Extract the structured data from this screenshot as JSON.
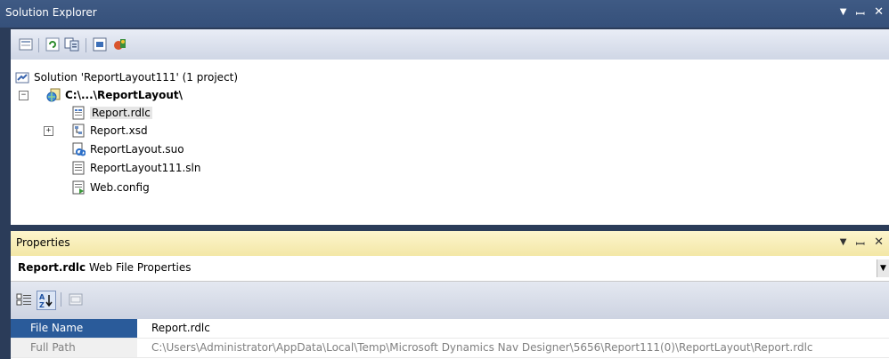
{
  "solution_explorer": {
    "title": "Solution Explorer",
    "controls": {
      "pin": "▾",
      "dock": "ꟷ",
      "close": "✕"
    },
    "toolbar_icons": [
      "show-all-files-icon",
      "refresh-icon",
      "nest-related-icon",
      "view-designer-icon",
      "build-icon"
    ],
    "tree": {
      "solution": "Solution 'ReportLayout111' (1 project)",
      "project": "C:\\...\\ReportLayout\\",
      "items": [
        {
          "label": "Report.rdlc",
          "icon": "report-file-icon"
        },
        {
          "label": "Report.xsd",
          "icon": "dataset-file-icon"
        },
        {
          "label": "ReportLayout.suo",
          "icon": "suo-file-icon"
        },
        {
          "label": "ReportLayout111.sln",
          "icon": "solution-file-icon"
        },
        {
          "label": "Web.config",
          "icon": "config-file-icon"
        }
      ]
    }
  },
  "properties": {
    "title": "Properties",
    "object_name": "Report.rdlc",
    "object_type": " Web File Properties",
    "grid": [
      {
        "key": "File Name",
        "value": "Report.rdlc"
      },
      {
        "key": "Full Path",
        "value": "C:\\Users\\Administrator\\AppData\\Local\\Temp\\Microsoft Dynamics Nav Designer\\5656\\Report111(0)\\ReportLayout\\Report.rdlc"
      }
    ]
  }
}
